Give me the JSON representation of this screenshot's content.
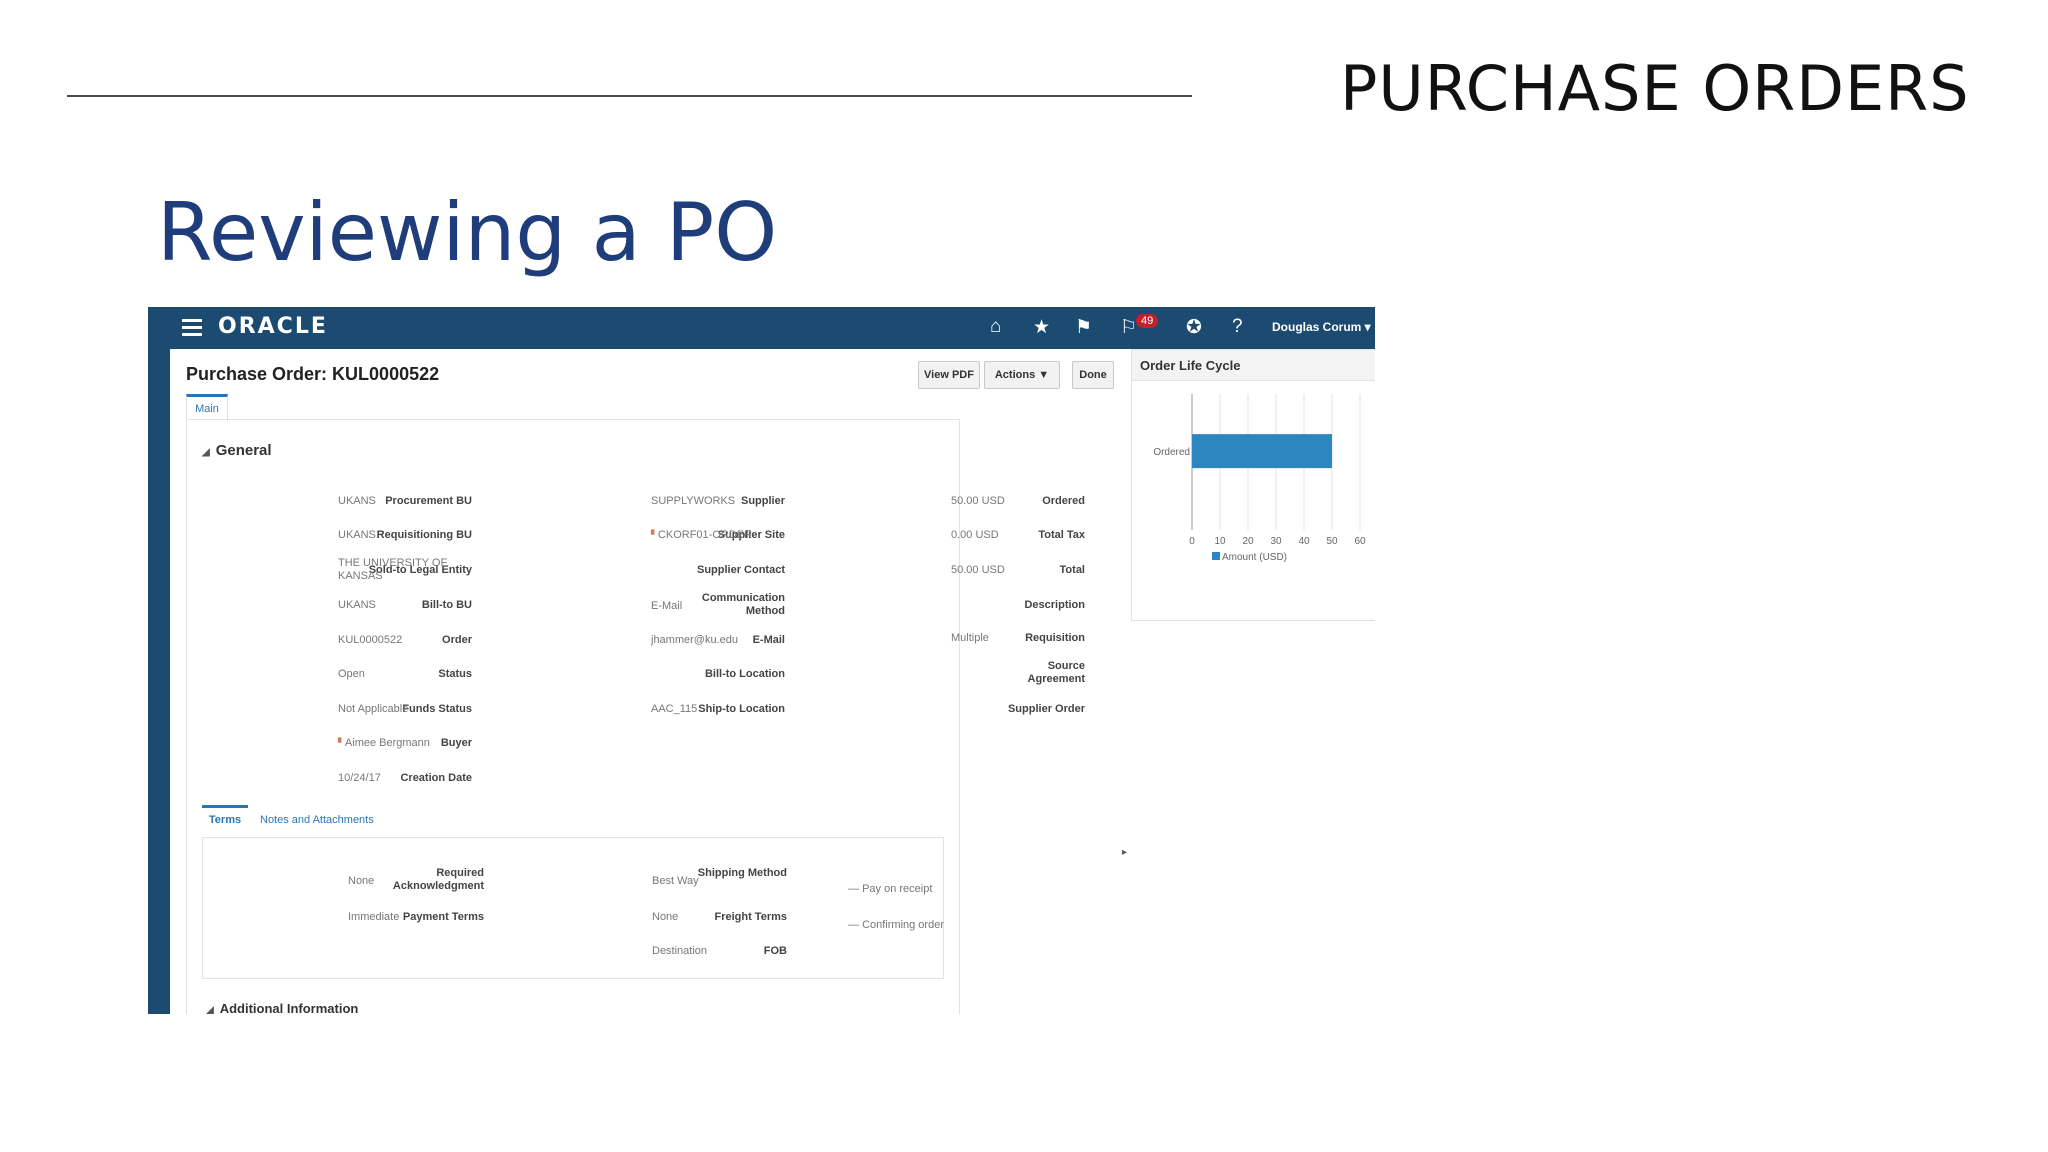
{
  "slide": {
    "header": "PURCHASE ORDERS",
    "title": "Reviewing a PO"
  },
  "topbar": {
    "logo": "ORACLE",
    "notifications_count": "49",
    "user_name": "Douglas Corum",
    "icons": [
      "home-icon",
      "star-icon",
      "flag-icon",
      "notifications-icon",
      "accessibility-icon",
      "help-icon"
    ]
  },
  "po": {
    "title": "Purchase Order: KUL0000522",
    "buttons": {
      "view_pdf": "View PDF",
      "actions": "Actions",
      "done": "Done"
    },
    "tab_main": "Main",
    "general_heading": "General",
    "col1": [
      {
        "label": "Procurement BU",
        "value": "UKANS"
      },
      {
        "label": "Requisitioning BU",
        "value": "UKANS"
      },
      {
        "label": "Sold-to Legal Entity",
        "value": "THE UNIVERSITY OF KANSAS"
      },
      {
        "label": "Bill-to BU",
        "value": "UKANS"
      },
      {
        "label": "Order",
        "value": "KUL0000522"
      },
      {
        "label": "Status",
        "value": "Open"
      },
      {
        "label": "Funds Status",
        "value": "Not Applicable"
      },
      {
        "label": "Buyer",
        "value": "Aimee Bergmann"
      },
      {
        "label": "Creation Date",
        "value": "10/24/17"
      }
    ],
    "col2": [
      {
        "label": "Supplier",
        "value": "SUPPLYWORKS"
      },
      {
        "label": "Supplier Site",
        "value": "CKORF01-ORDER"
      },
      {
        "label": "Supplier Contact",
        "value": ""
      },
      {
        "label": "Communication Method",
        "value": "E-Mail"
      },
      {
        "label": "E-Mail",
        "value": "jhammer@ku.edu"
      },
      {
        "label": "Bill-to Location",
        "value": ""
      },
      {
        "label": "Ship-to Location",
        "value": "AAC_115"
      }
    ],
    "col3": [
      {
        "label": "Ordered",
        "value": "50.00 USD"
      },
      {
        "label": "Total Tax",
        "value": "0.00 USD"
      },
      {
        "label": "Total",
        "value": "50.00 USD"
      },
      {
        "label": "Description",
        "value": ""
      },
      {
        "label": "Requisition",
        "value": "Multiple"
      },
      {
        "label": "Source Agreement",
        "value": ""
      },
      {
        "label": "Supplier Order",
        "value": ""
      }
    ],
    "subtabs": {
      "terms": "Terms",
      "notes": "Notes and Attachments"
    },
    "terms_col1": [
      {
        "label": "Required Acknowledgment",
        "value": "None"
      },
      {
        "label": "Payment Terms",
        "value": "Immediate"
      }
    ],
    "terms_col2": [
      {
        "label": "Shipping Method",
        "value": "Best Way"
      },
      {
        "label": "Freight Terms",
        "value": "None"
      },
      {
        "label": "FOB",
        "value": "Destination"
      }
    ],
    "terms_col3": [
      "Pay on receipt",
      "Confirming order"
    ],
    "additional_heading": "Additional Information"
  },
  "lifecycle": {
    "title": "Order Life Cycle"
  },
  "chart_data": {
    "type": "bar",
    "orientation": "horizontal",
    "categories": [
      "Ordered"
    ],
    "series": [
      {
        "name": "Amount (USD)",
        "values": [
          50
        ]
      }
    ],
    "xlim": [
      0,
      60
    ],
    "xticks": [
      0,
      10,
      20,
      30,
      40,
      50,
      60
    ],
    "bar_color": "#2e86c1",
    "legend": "bottom",
    "grid": true
  }
}
